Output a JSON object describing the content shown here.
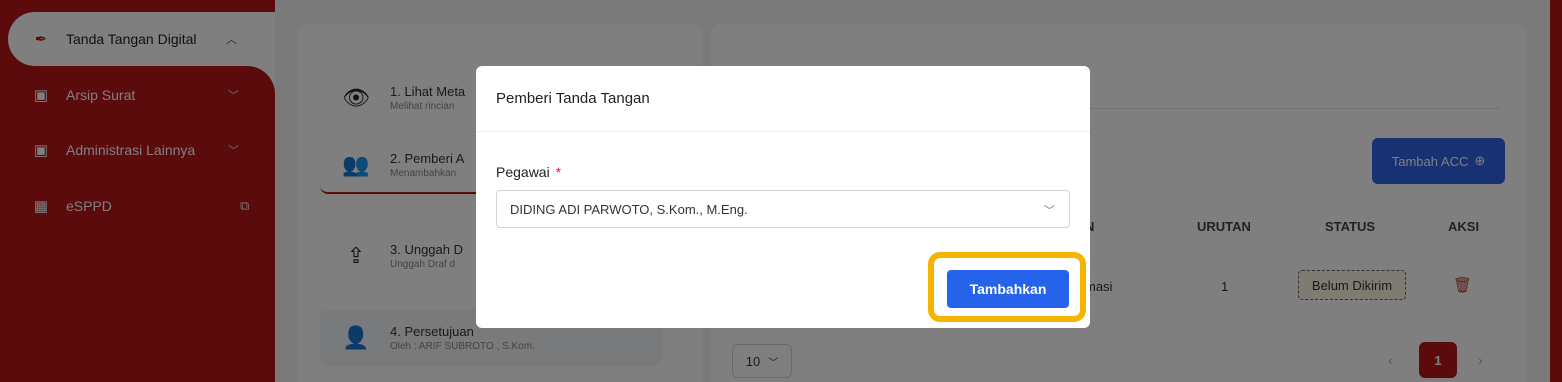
{
  "sidebar": {
    "items": [
      {
        "label": "Tanda Tangan Digital",
        "icon": "pen-nib-icon"
      },
      {
        "label": "Arsip Surat",
        "icon": "archive-icon"
      },
      {
        "label": "Administrasi Lainnya",
        "icon": "archive-icon"
      },
      {
        "label": "eSPPD",
        "icon": "building-icon",
        "external_icon": "external-link-icon"
      }
    ]
  },
  "steps": [
    {
      "title": "1. Lihat Meta",
      "subtitle": "Melihat rincian",
      "icon": "eye-icon"
    },
    {
      "title": "2. Pemberi A",
      "subtitle": "Menambahkan",
      "icon": "users-icon"
    },
    {
      "title": "3. Unggah D",
      "subtitle": "Unggah Draf d",
      "icon": "upload-icon"
    },
    {
      "title": "4. Persetujuan",
      "subtitle": "Oleh : ARIF SUBROTO , S.Kom.",
      "icon": "user-check-icon"
    }
  ],
  "acc_panel": {
    "add_button": "Tambah ACC",
    "columns": [
      "N",
      "URUTAN",
      "STATUS",
      "AKSI"
    ],
    "row": {
      "name_tail": "masi",
      "order": "1",
      "status": "Belum Dikirim"
    },
    "per_page": "10",
    "current_page": "1"
  },
  "modal": {
    "title": "Pemberi Tanda Tangan",
    "field_label": "Pegawai",
    "required_mark": "*",
    "selected_value": "DIDING ADI PARWOTO, S.Kom., M.Eng.",
    "submit_label": "Tambahkan"
  },
  "colors": {
    "brand_red": "#b8161a",
    "primary_blue": "#2563eb",
    "highlight": "#f4b400"
  }
}
